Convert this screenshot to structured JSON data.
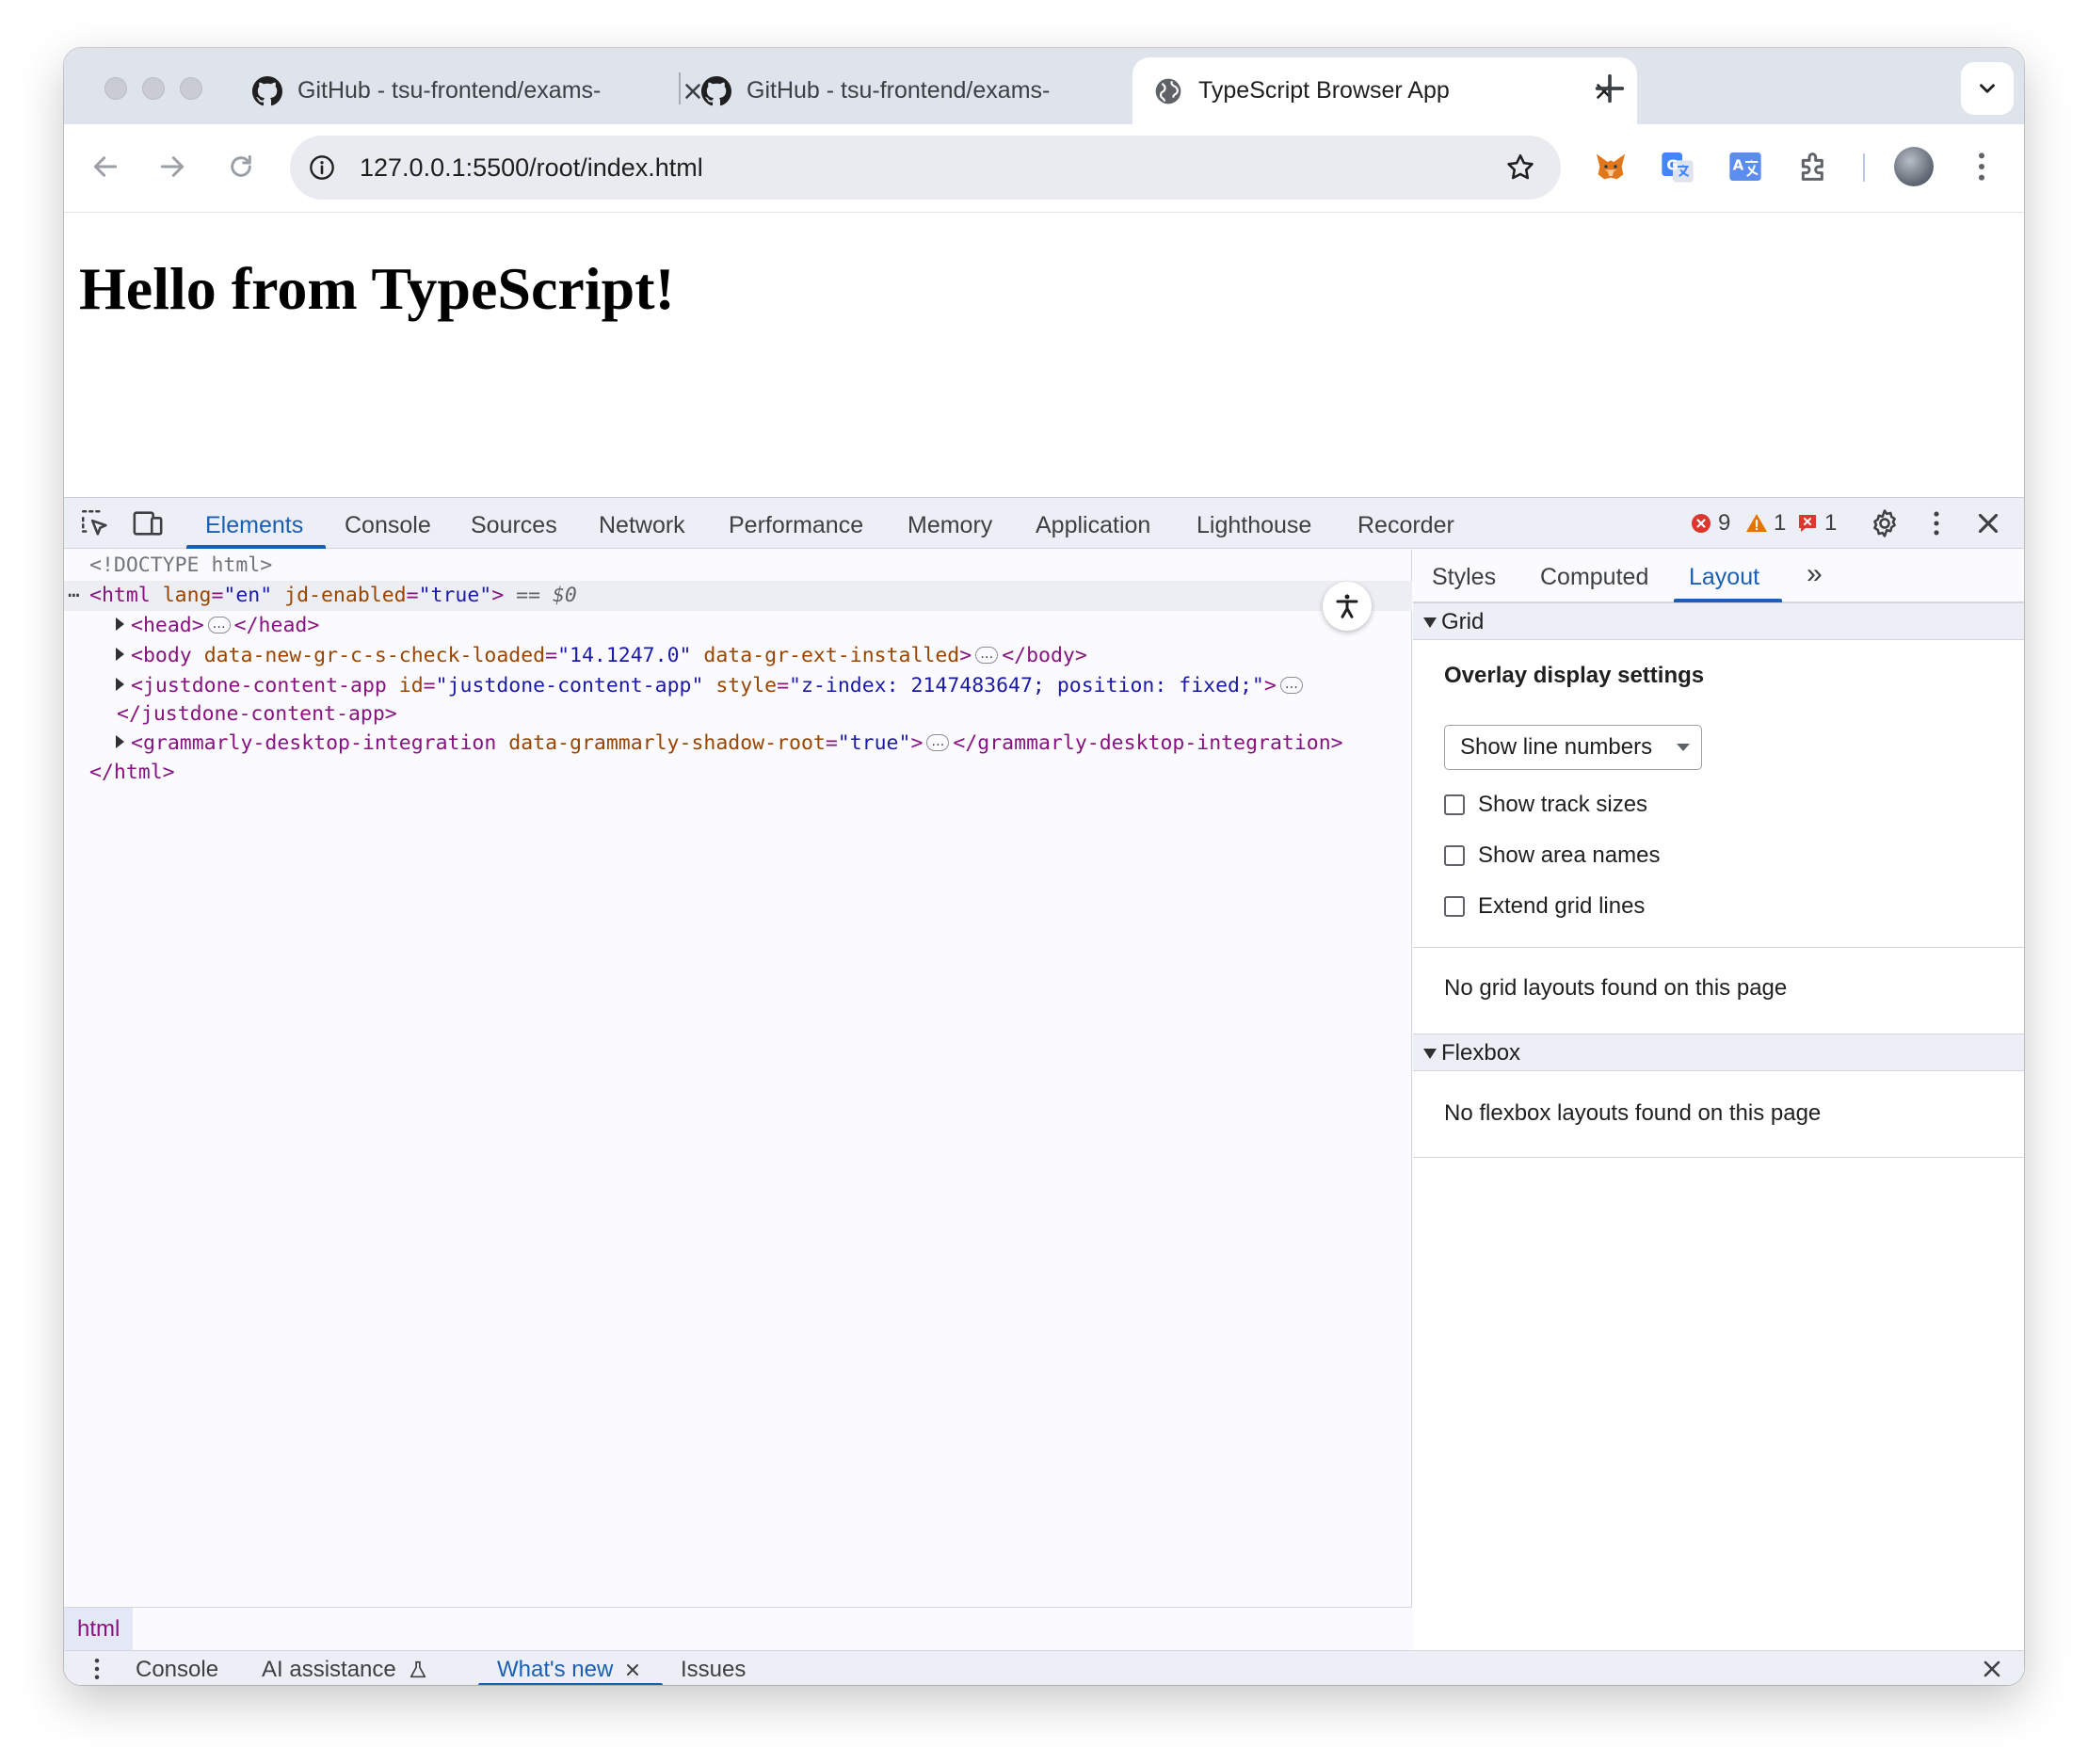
{
  "browser": {
    "tabs": [
      {
        "title": "GitHub - tsu-frontend/exams-",
        "favicon": "github-icon",
        "active": false
      },
      {
        "title": "GitHub - tsu-frontend/exams-",
        "favicon": "github-icon",
        "active": false
      },
      {
        "title": "TypeScript Browser App",
        "favicon": "globe-icon",
        "active": true
      }
    ],
    "url": "127.0.0.1:5500/root/index.html",
    "extensions": [
      "metamask-fox-icon",
      "google-translate-icon",
      "translate-icon",
      "puzzle-icon"
    ]
  },
  "page": {
    "heading": "Hello from TypeScript!"
  },
  "devtools": {
    "tabs": [
      "Elements",
      "Console",
      "Sources",
      "Network",
      "Performance",
      "Memory",
      "Application",
      "Lighthouse",
      "Recorder"
    ],
    "active_tab": "Elements",
    "badges": {
      "errors": "9",
      "warnings": "1",
      "issues": "1"
    },
    "dom": {
      "doctype": "<!DOCTYPE html>",
      "html_open": {
        "tag": "<html",
        "attr1_name": "lang",
        "attr1_value": "\"en\"",
        "attr2_name": "jd-enabled",
        "attr2_value": "\"true\"",
        "close": ">",
        "selected_marker": " == $0"
      },
      "head": {
        "open": "<head>",
        "close": "</head>"
      },
      "body": {
        "open": "<body",
        "attr1_name": "data-new-gr-c-s-check-loaded",
        "attr1_value": "\"14.1247.0\"",
        "attr2_name": "data-gr-ext-installed",
        "gt": ">",
        "close": "</body>"
      },
      "justdone": {
        "open": "<justdone-content-app",
        "attr1_name": "id",
        "attr1_value": "\"justdone-content-app\"",
        "attr2_name": "style",
        "attr2_value": "\"z-index: 2147483647; position: fixed;\"",
        "gt": ">",
        "close": "</justdone-content-app>"
      },
      "grammarly": {
        "open": "<grammarly-desktop-integration",
        "attr1_name": "data-grammarly-shadow-root",
        "attr1_value": "\"true\"",
        "gt": ">",
        "close": "</grammarly-desktop-integration>"
      },
      "html_close": "</html>"
    },
    "breadcrumb": "html",
    "sidebar": {
      "tabs": [
        "Styles",
        "Computed",
        "Layout"
      ],
      "active_tab": "Layout",
      "more": "»",
      "grid": {
        "title": "Grid",
        "overlay_title": "Overlay display settings",
        "select_value": "Show line numbers",
        "checkboxes": [
          "Show track sizes",
          "Show area names",
          "Extend grid lines"
        ],
        "empty_message": "No grid layouts found on this page"
      },
      "flexbox": {
        "title": "Flexbox",
        "empty_message": "No flexbox layouts found on this page"
      }
    },
    "drawer": {
      "tabs": [
        "Console",
        "AI assistance",
        "What's new",
        "Issues"
      ],
      "active_tab": "What's new"
    }
  },
  "colors": {
    "accent": "#1a5fb4",
    "tag": "#881280",
    "attr_name": "#994500",
    "attr_value": "#1a1aa6",
    "error": "#dc362e",
    "warning": "#e37400"
  }
}
